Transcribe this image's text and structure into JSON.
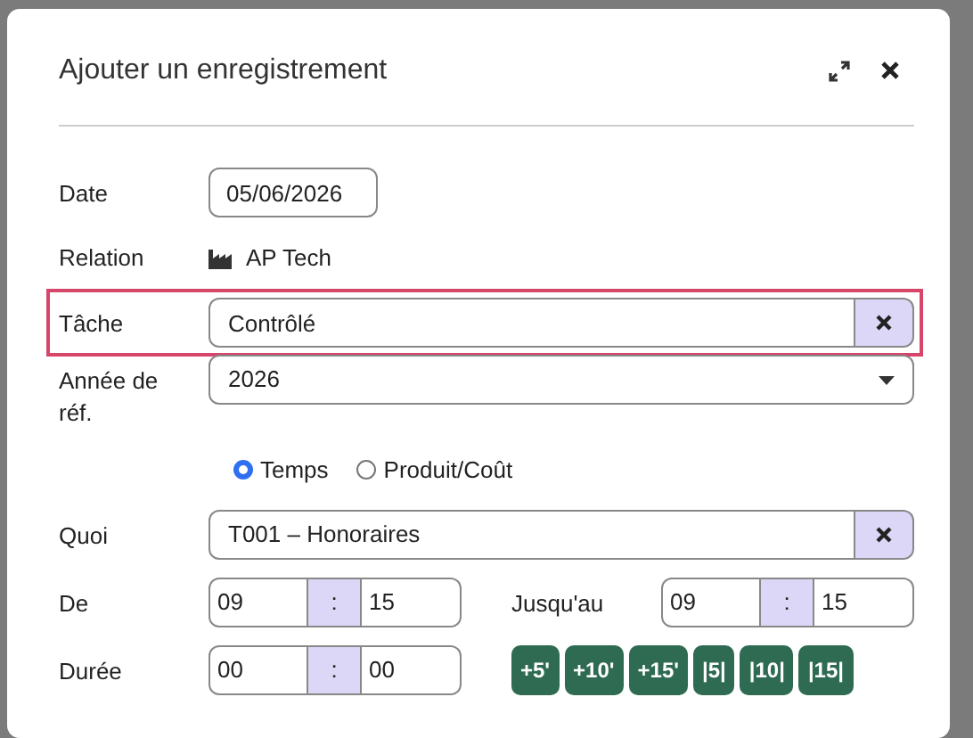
{
  "dialog": {
    "title": "Ajouter un enregistrement"
  },
  "fields": [
    {
      "kind": "date",
      "label": "Date",
      "value": "05/06/2026",
      "highlighted": false
    },
    {
      "kind": "static",
      "label": "Relation",
      "value": "AP Tech",
      "highlighted": false
    },
    {
      "kind": "lookup",
      "label": "Tâche",
      "value": "Contrôlé",
      "highlighted": true
    },
    {
      "kind": "select",
      "label": "Année de réf.",
      "value": "2026",
      "highlighted": false
    }
  ],
  "entry_type": [
    {
      "label": "Temps",
      "selected": true
    },
    {
      "label": "Produit/Coût",
      "selected": false
    }
  ],
  "what": {
    "label": "Quoi",
    "value": "T001 – Honoraires"
  },
  "from": {
    "label": "De",
    "hours": "09",
    "separator": ":",
    "minutes": "15"
  },
  "until": {
    "label": "Jusqu'au",
    "hours": "09",
    "separator": ":",
    "minutes": "15"
  },
  "duration": {
    "label": "Durée",
    "hours": "00",
    "separator": ":",
    "minutes": "00"
  },
  "quick_buttons": [
    "+5'",
    "+10'",
    "+15'",
    "|5|",
    "|10|",
    "|15|"
  ]
}
